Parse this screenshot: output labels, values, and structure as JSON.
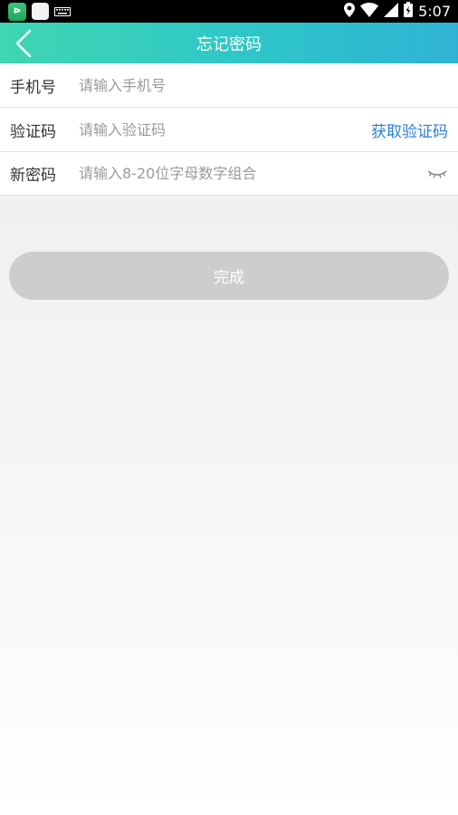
{
  "status_bar": {
    "time": "5:07",
    "app_icon_1_text": "ᐅ",
    "icons": [
      "app-icon",
      "blank-app-icon",
      "keyboard-icon",
      "location-icon",
      "wifi-icon",
      "signal-icon",
      "battery-icon"
    ]
  },
  "nav": {
    "title": "忘记密码",
    "back_icon": "chevron-left-icon"
  },
  "form": {
    "phone": {
      "label": "手机号",
      "placeholder": "请输入手机号",
      "value": ""
    },
    "code": {
      "label": "验证码",
      "placeholder": "请输入验证码",
      "value": "",
      "action_label": "获取验证码"
    },
    "password": {
      "label": "新密码",
      "placeholder": "请输入8-20位字母数字组合",
      "value": "",
      "toggle_icon": "eye-closed-icon"
    }
  },
  "submit": {
    "label": "完成"
  },
  "colors": {
    "nav_gradient_start": "#3fd6b2",
    "nav_gradient_end": "#2fb3d5",
    "link_blue": "#2a7fd6",
    "button_disabled": "#cdcdcd"
  }
}
